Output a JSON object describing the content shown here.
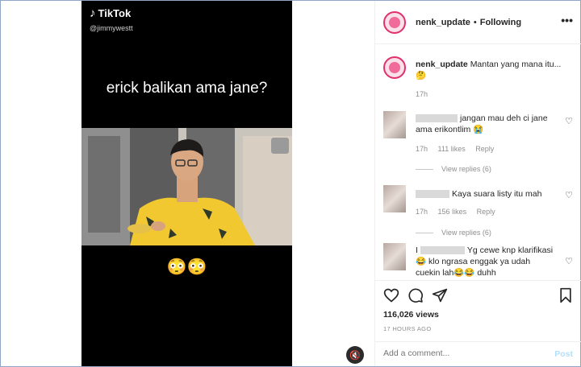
{
  "video": {
    "brand": "TikTok",
    "handle": "@jimmywestt",
    "caption": "erick balikan ama jane?",
    "emojis": "😳😳"
  },
  "post": {
    "username": "nenk_update",
    "separator": "•",
    "following": "Following",
    "more": "•••"
  },
  "owner_comment": {
    "username": "nenk_update",
    "text": "Mantan yang mana itu... 🤔",
    "time": "17h"
  },
  "comments": [
    {
      "text": "jangan mau deh ci jane ama erikontlim 😭",
      "time": "17h",
      "likes": "111 likes",
      "reply": "Reply",
      "view_replies": "View replies (6)"
    },
    {
      "text": "Kaya suara listy itu mah",
      "time": "17h",
      "likes": "156 likes",
      "reply": "Reply",
      "view_replies": "View replies (6)"
    },
    {
      "prefix": "I",
      "text": "Yg cewe knp klarifikasi 😂 klo ngrasa enggak ya udah cuekin lah😂😂 duhh"
    }
  ],
  "stats": {
    "views": "116,026 views",
    "ago": "17 HOURS AGO"
  },
  "add_comment": {
    "placeholder": "Add a comment...",
    "post_label": "Post"
  }
}
